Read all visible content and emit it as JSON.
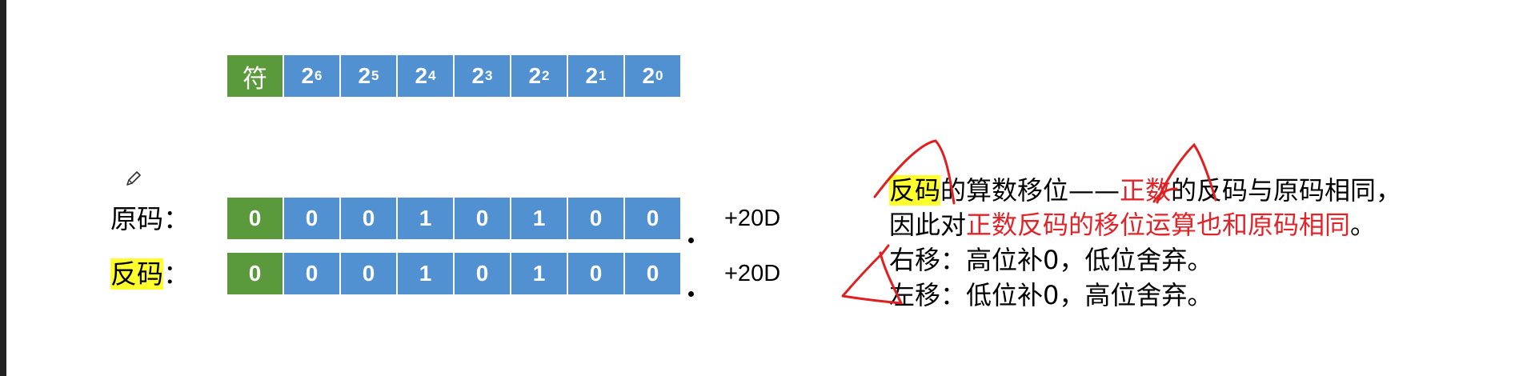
{
  "header_row": {
    "sign_label": "符",
    "bits": [
      {
        "base": "2",
        "exp": "6"
      },
      {
        "base": "2",
        "exp": "5"
      },
      {
        "base": "2",
        "exp": "4"
      },
      {
        "base": "2",
        "exp": "3"
      },
      {
        "base": "2",
        "exp": "2"
      },
      {
        "base": "2",
        "exp": "1"
      },
      {
        "base": "2",
        "exp": "0"
      }
    ]
  },
  "original_code": {
    "label": "原码",
    "colon": "：",
    "bits": [
      "0",
      "0",
      "0",
      "1",
      "0",
      "1",
      "0",
      "0"
    ],
    "decimal": "+20D"
  },
  "ones_complement": {
    "label": "反码",
    "colon": "：",
    "bits": [
      "0",
      "0",
      "0",
      "1",
      "0",
      "1",
      "0",
      "0"
    ],
    "decimal": "+20D"
  },
  "notes": {
    "line1": {
      "hl_term": "反码",
      "part_a": "的算数移位——",
      "red_term": "正数",
      "part_b": "的反码与原码相同，"
    },
    "line2": {
      "part_a": "因此对",
      "red_term": "正数反码的移位运算也和原码相同",
      "part_b": "。"
    },
    "line3": "右移：高位补0，低位舍弃。",
    "line4": "左移：低位补0，高位舍弃。"
  },
  "colors": {
    "sign_cell": "#5a9a3c",
    "bit_cell": "#5191d1",
    "highlight": "#ffff2e",
    "red_text": "#e0242a",
    "ink": "#e02020"
  }
}
